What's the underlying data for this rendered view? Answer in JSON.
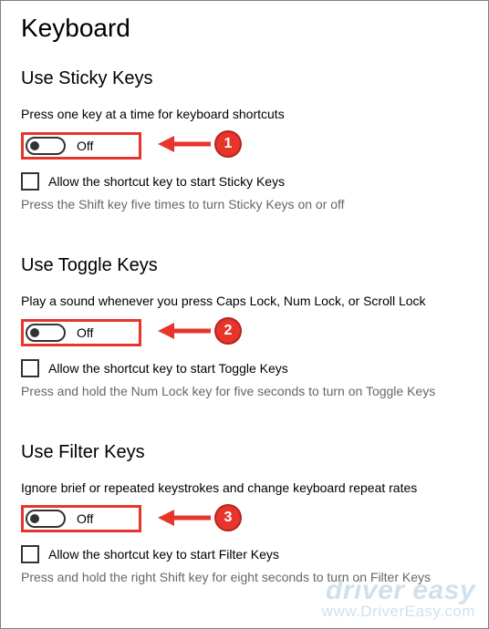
{
  "page_title": "Keyboard",
  "sections": {
    "sticky": {
      "title": "Use Sticky Keys",
      "description": "Press one key at a time for keyboard shortcuts",
      "toggle_state": "Off",
      "checkbox_label": "Allow the shortcut key to start Sticky Keys",
      "hint": "Press the Shift key five times to turn Sticky Keys on or off"
    },
    "toggle": {
      "title": "Use Toggle Keys",
      "description": "Play a sound whenever you press Caps Lock, Num Lock, or Scroll Lock",
      "toggle_state": "Off",
      "checkbox_label": "Allow the shortcut key to start Toggle Keys",
      "hint": "Press and hold the Num Lock key for five seconds to turn on Toggle Keys"
    },
    "filter": {
      "title": "Use Filter Keys",
      "description": "Ignore brief or repeated keystrokes and change keyboard repeat rates",
      "toggle_state": "Off",
      "checkbox_label": "Allow the shortcut key to start Filter Keys",
      "hint": "Press and hold the right Shift key for eight seconds to turn on Filter Keys"
    }
  },
  "annotations": {
    "badge1": "1",
    "badge2": "2",
    "badge3": "3"
  },
  "watermark": {
    "line1": "driver easy",
    "line2": "www.DriverEasy.com"
  }
}
